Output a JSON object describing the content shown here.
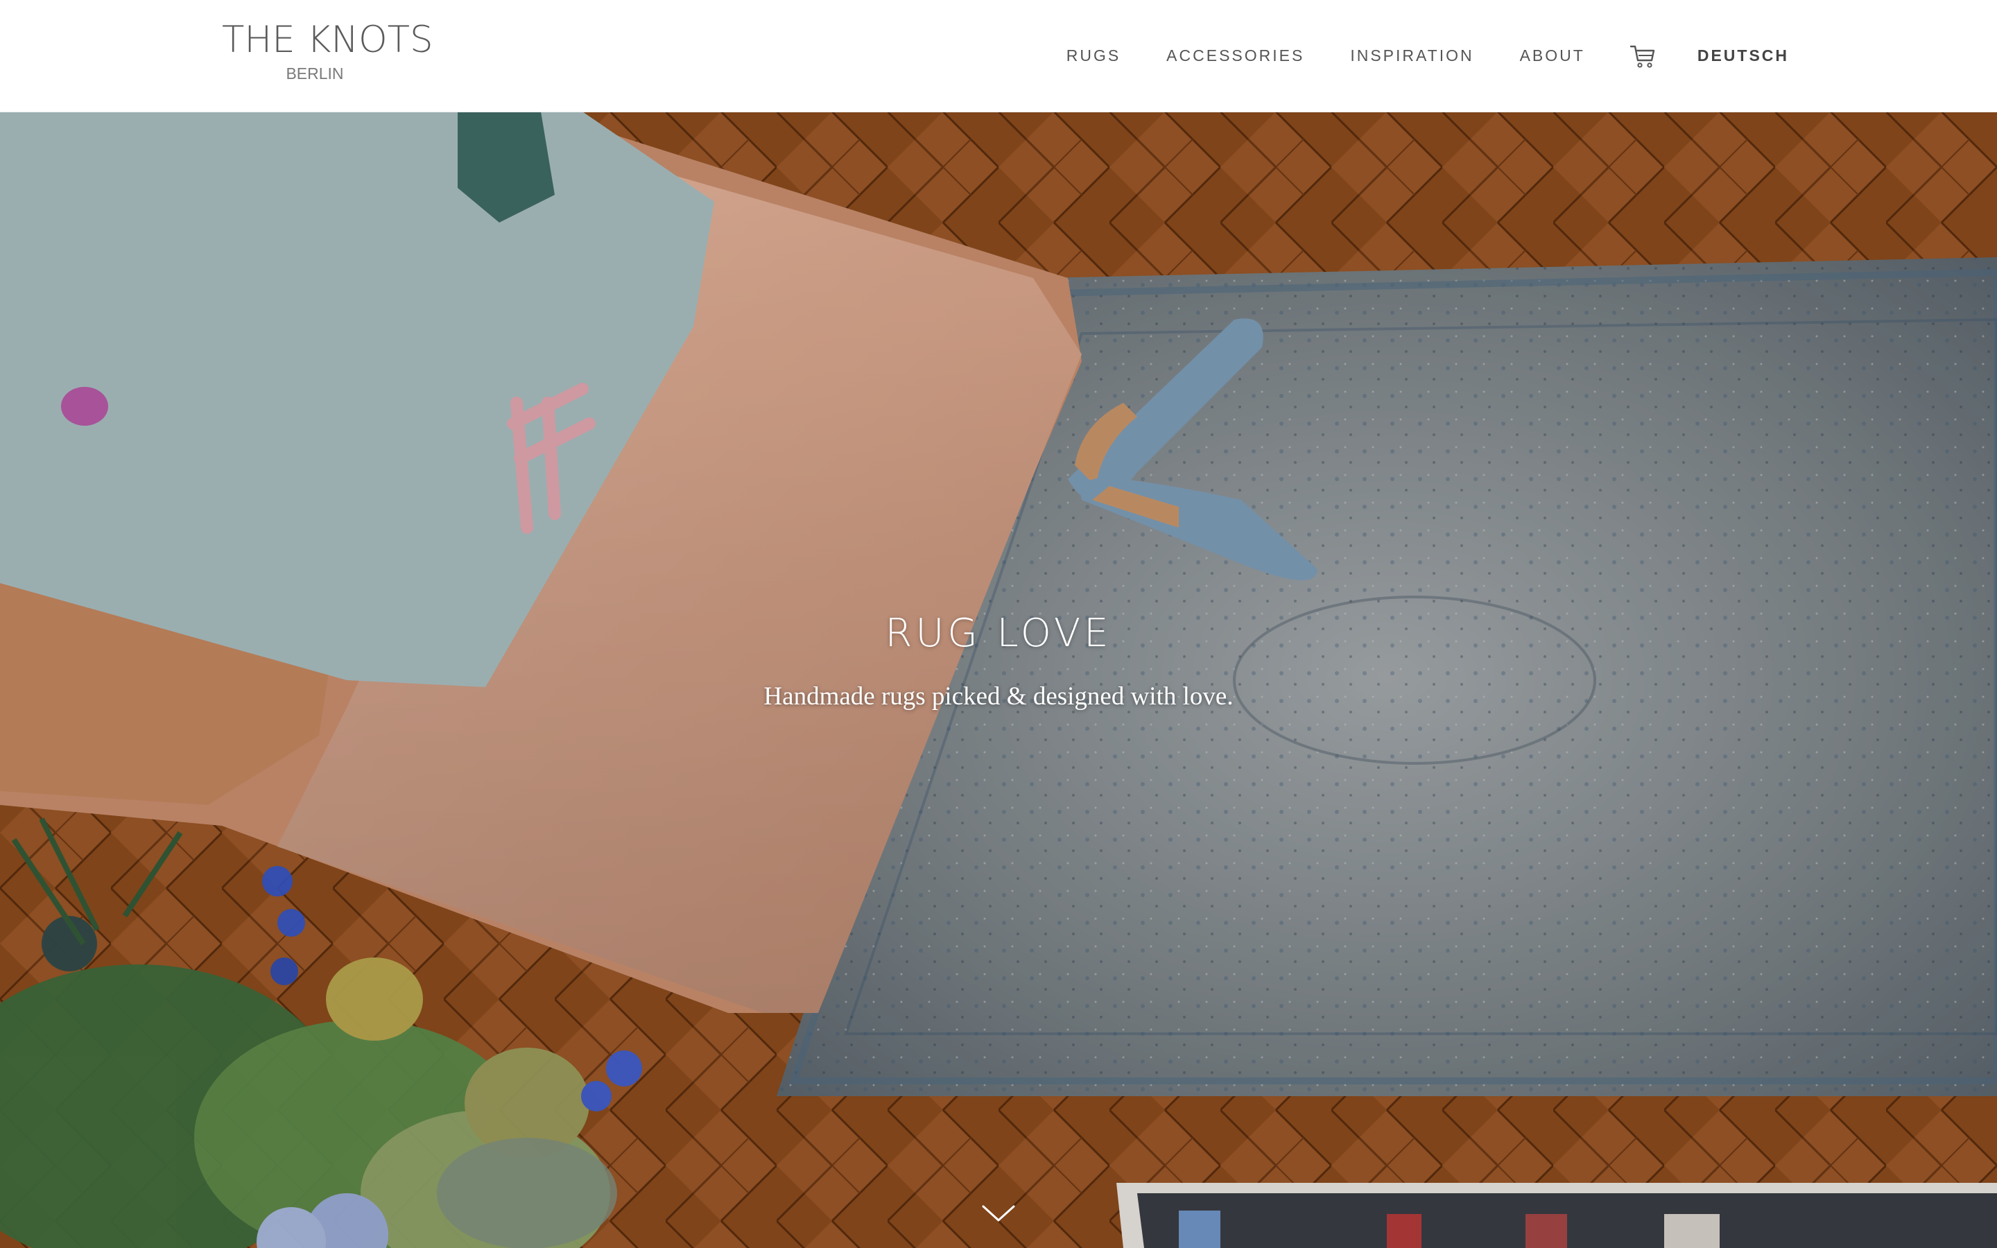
{
  "brand": {
    "name": "THE KNOTS",
    "city": "BERLIN"
  },
  "nav": {
    "items": [
      {
        "label": "RUGS"
      },
      {
        "label": "ACCESSORIES"
      },
      {
        "label": "INSPIRATION"
      },
      {
        "label": "ABOUT"
      }
    ],
    "cart_icon": "shopping-cart-icon",
    "language": "DEUTSCH"
  },
  "hero": {
    "title": "RUG LOVE",
    "subtitle": "Handmade rugs picked & designed with love.",
    "scroll_icon": "chevron-down-icon",
    "colors": {
      "floor": "#8a4a1c",
      "rug": "#8e959a",
      "sofa": "#e2ae94",
      "pillow": "#a7bcbe",
      "shoe": "#7d9db8"
    }
  }
}
